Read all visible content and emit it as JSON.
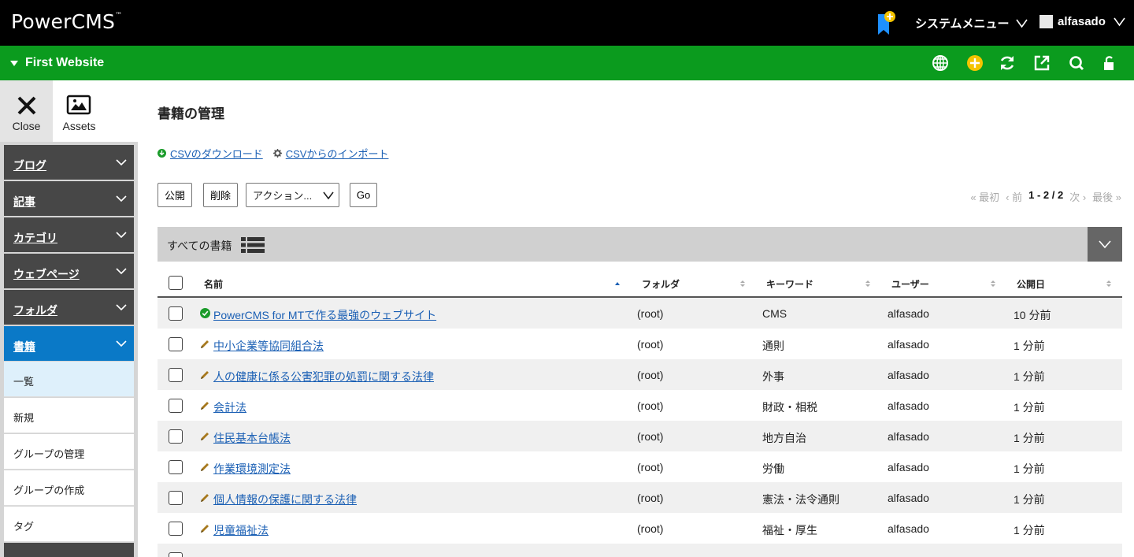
{
  "app": {
    "logo": "PowerCMS",
    "logo_mark": "™"
  },
  "topbar": {
    "system_menu": "システムメニュー",
    "username": "alfasado"
  },
  "site": {
    "name": "First Website",
    "icons": [
      "globe-icon",
      "add-icon",
      "refresh-icon",
      "external-link-icon",
      "search-icon",
      "lock-icon"
    ]
  },
  "side_top": {
    "close": "Close",
    "assets": "Assets"
  },
  "sidebar": {
    "items": [
      {
        "label": "ブログ"
      },
      {
        "label": "記事"
      },
      {
        "label": "カテゴリ"
      },
      {
        "label": "ウェブページ"
      },
      {
        "label": "フォルダ"
      },
      {
        "label": "書籍"
      }
    ],
    "sub_items": [
      {
        "label": "一覧"
      },
      {
        "label": "新規"
      },
      {
        "label": "グループの管理"
      },
      {
        "label": "グループの作成"
      },
      {
        "label": "タグ"
      }
    ]
  },
  "main": {
    "title": "書籍の管理",
    "csv_download": "CSVのダウンロード",
    "csv_import": "CSVからのインポート",
    "publish_button": "公開",
    "delete_button": "削除",
    "action_select": "アクション...",
    "go_button": "Go",
    "pager": {
      "first": "« 最初",
      "prev": "‹ 前",
      "current": "1 - 2 / 2",
      "next": "次 ›",
      "last": "最後 »"
    },
    "filter_label": "すべての書籍"
  },
  "table": {
    "headers": {
      "name": "名前",
      "folder": "フォルダ",
      "keyword": "キーワード",
      "user": "ユーザー",
      "date": "公開日"
    },
    "rows": [
      {
        "status": "published",
        "title": "PowerCMS for MTで作る最強のウェブサイト",
        "folder": "(root)",
        "keyword": "CMS",
        "user": "alfasado",
        "date": "10 分前"
      },
      {
        "status": "draft",
        "title": "中小企業等協同組合法",
        "folder": "(root)",
        "keyword": "通則",
        "user": "alfasado",
        "date": "1 分前"
      },
      {
        "status": "draft",
        "title": "人の健康に係る公害犯罪の処罰に関する法律",
        "folder": "(root)",
        "keyword": "外事",
        "user": "alfasado",
        "date": "1 分前"
      },
      {
        "status": "draft",
        "title": "会計法",
        "folder": "(root)",
        "keyword": "財政・相税",
        "user": "alfasado",
        "date": "1 分前"
      },
      {
        "status": "draft",
        "title": "住民基本台帳法",
        "folder": "(root)",
        "keyword": "地方自治",
        "user": "alfasado",
        "date": "1 分前"
      },
      {
        "status": "draft",
        "title": "作業環境測定法",
        "folder": "(root)",
        "keyword": "労働",
        "user": "alfasado",
        "date": "1 分前"
      },
      {
        "status": "draft",
        "title": "個人情報の保護に関する法律",
        "folder": "(root)",
        "keyword": "憲法・法令通則",
        "user": "alfasado",
        "date": "1 分前"
      },
      {
        "status": "draft",
        "title": "児童福祉法",
        "folder": "(root)",
        "keyword": "福祉・厚生",
        "user": "alfasado",
        "date": "1 分前"
      }
    ]
  },
  "colors": {
    "topbar": "#000000",
    "sitebar": "#0b9b1e",
    "nav": "#474747",
    "nav_active": "#0a79c7",
    "link": "#1a5fb4",
    "accent_yellow": "#f5c400"
  }
}
